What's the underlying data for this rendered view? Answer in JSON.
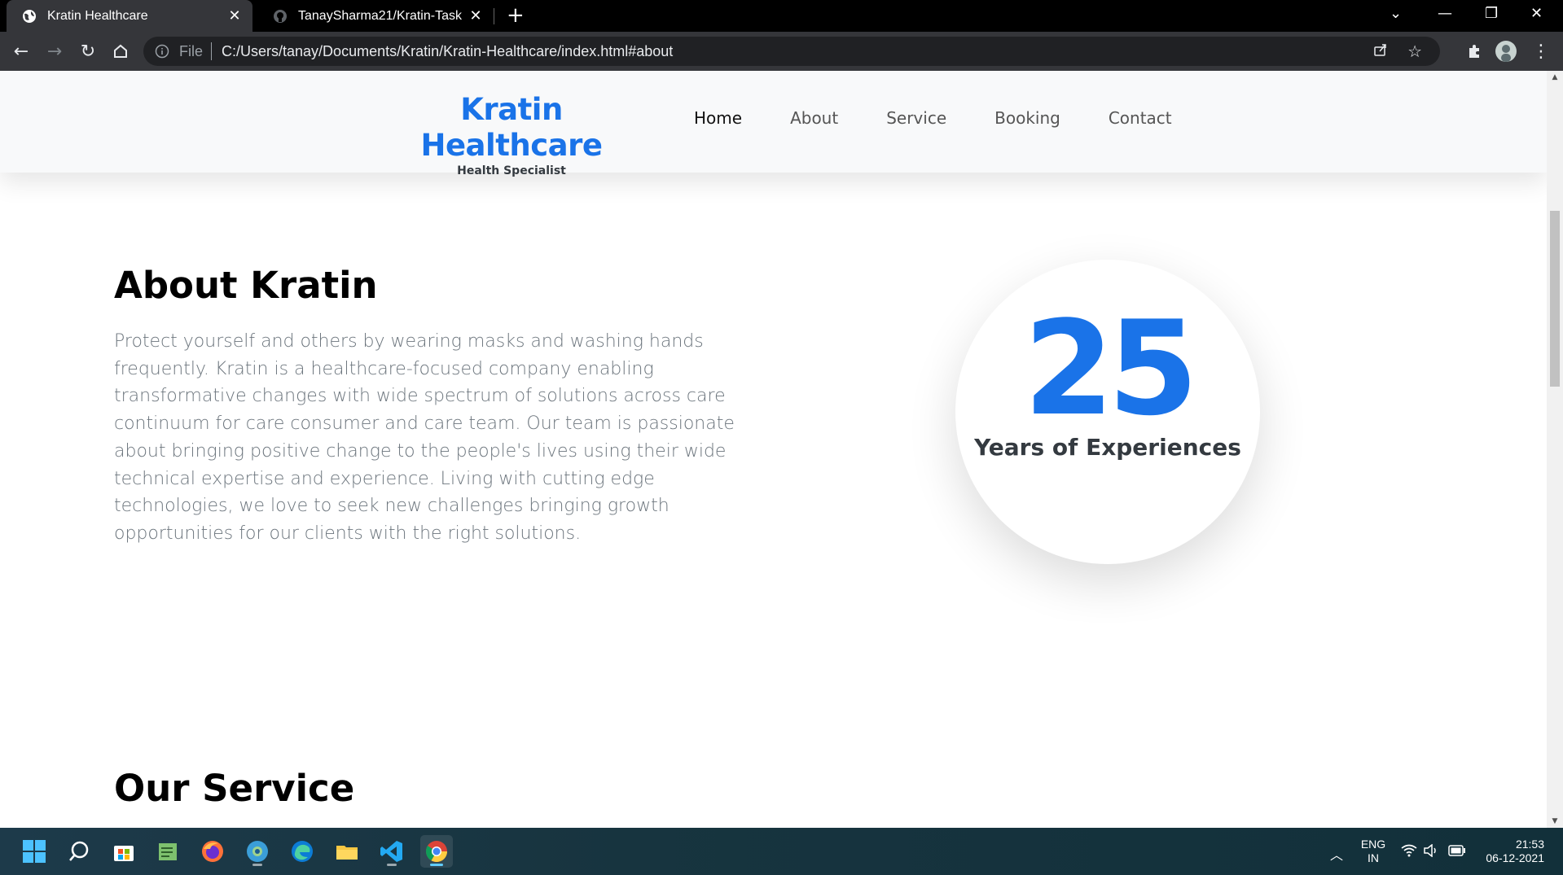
{
  "browser": {
    "tabs": [
      {
        "title": "Kratin Healthcare",
        "active": true,
        "icon": "globe-icon"
      },
      {
        "title": "TanaySharma21/Kratin-Task",
        "active": false,
        "icon": "github-icon"
      }
    ],
    "address_bar": {
      "scheme_label": "File",
      "url": "C:/Users/tanay/Documents/Kratin/Kratin-Healthcare/index.html#about"
    }
  },
  "site": {
    "brand": {
      "name": "Kratin Healthcare",
      "tagline": "Health Specialist"
    },
    "nav": [
      "Home",
      "About",
      "Service",
      "Booking",
      "Contact"
    ],
    "active_nav": "Home",
    "colors": {
      "accent": "#1a73e8",
      "header_bg": "#f8f9fa",
      "text_muted": "#6c757d"
    }
  },
  "about": {
    "title": "About Kratin",
    "body": "Protect yourself and others by wearing masks and washing hands frequently. Kratin is a healthcare-focused company enabling transformative changes with wide spectrum of solutions across care continuum for care consumer and care team. Our team is passionate about bringing positive change to the people's lives using their wide technical expertise and experience. Living with cutting edge technologies, we love to seek new challenges bringing growth opportunities for our clients with the right solutions.",
    "experience": {
      "number": "25",
      "label": "Years of Experiences"
    }
  },
  "service": {
    "title": "Our Service"
  },
  "taskbar": {
    "apps": [
      "windows-start-icon",
      "search-icon",
      "microsoft-store-icon",
      "notepad-icon",
      "firefox-icon",
      "edge-beta-icon",
      "edge-icon",
      "file-explorer-icon",
      "vscode-icon",
      "chrome-icon"
    ],
    "tray": {
      "language_line1": "ENG",
      "language_line2": "IN",
      "time": "21:53",
      "date": "06-12-2021"
    }
  }
}
